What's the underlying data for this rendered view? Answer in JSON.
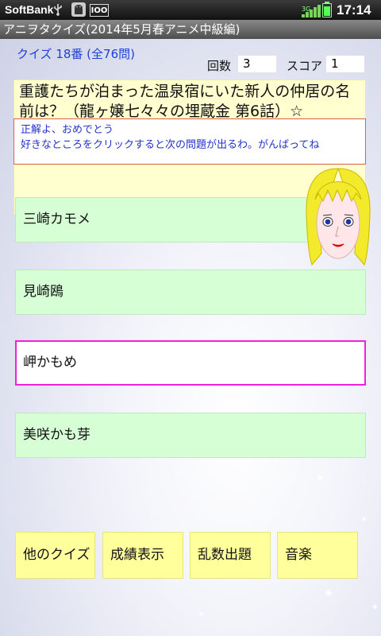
{
  "statusbar": {
    "carrier": "SoftBank",
    "notification_badge": "IOO",
    "network_label": "3G",
    "time": "17:14"
  },
  "app": {
    "title": "アニヲタクイズ(2014年5月春アニメ中級編)"
  },
  "quiz": {
    "progress_label": "クイズ 18番 (全76問)",
    "count_label": "回数",
    "count_value": "3",
    "score_label": "スコア",
    "score_value": "1",
    "question": "重護たちが泊まった温泉宿にいた新人の仲居の名前は？（龍ヶ嬢七々々の埋蔵金 第6話）☆",
    "feedback_line1": "正解よ、おめでとう",
    "feedback_line2": "好きなところをクリックすると次の問題が出るわ。がんばってね"
  },
  "answers": [
    {
      "label": "三崎カモメ",
      "selected": false
    },
    {
      "label": "見崎鴎",
      "selected": false
    },
    {
      "label": "岬かもめ",
      "selected": true
    },
    {
      "label": "美咲かも芽",
      "selected": false
    }
  ],
  "buttons": {
    "other_quiz": "他のクイズ",
    "show_results": "成績表示",
    "random_question": "乱数出題",
    "music": "音楽"
  },
  "colors": {
    "answer_bg": "#d6ffd6",
    "selected_border": "#ee22dd",
    "question_bg": "#ffffcf",
    "button_bg": "#ffff9c",
    "feedback_border": "#d9664a",
    "link_blue": "#1f3fd6"
  },
  "icons": [
    "usb-icon",
    "android-debug-icon",
    "signal-icon",
    "battery-icon",
    "avatar-girl"
  ]
}
